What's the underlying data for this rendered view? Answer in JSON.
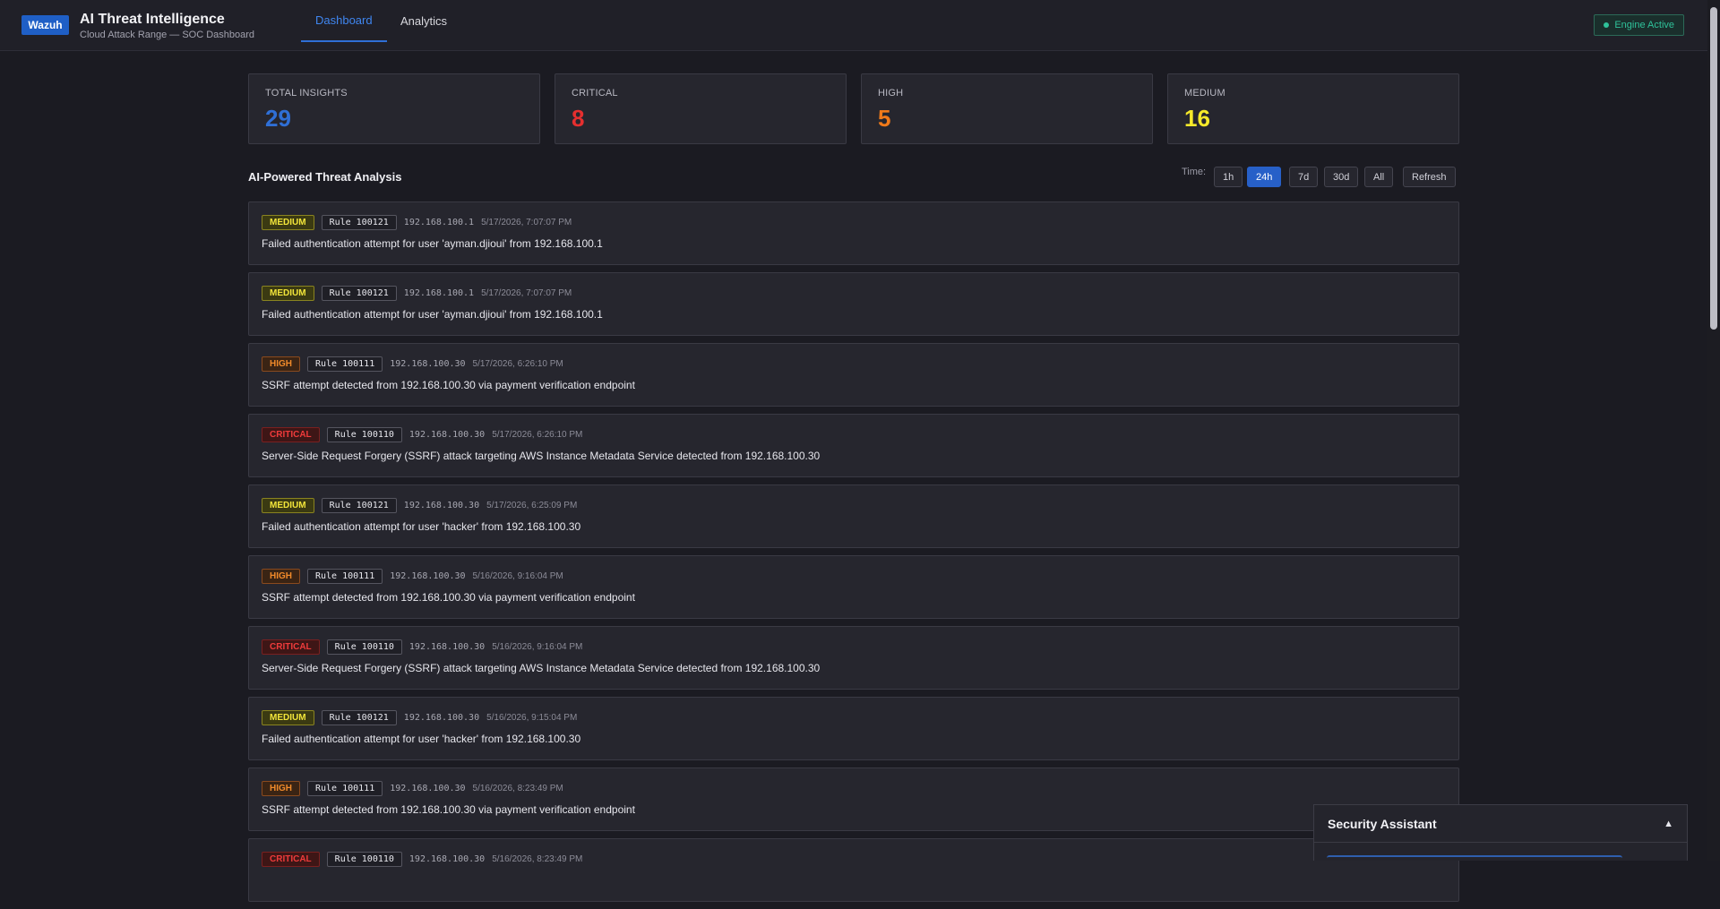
{
  "header": {
    "logo": "Wazuh",
    "title": "AI Threat Intelligence",
    "subtitle": "Cloud Attack Range — SOC Dashboard",
    "tabs": [
      {
        "label": "Dashboard",
        "active": true
      },
      {
        "label": "Analytics",
        "active": false
      }
    ],
    "engine_status": "Engine Active"
  },
  "stats": [
    {
      "label": "TOTAL INSIGHTS",
      "value": "29",
      "color": "#2f6fd6"
    },
    {
      "label": "CRITICAL",
      "value": "8",
      "color": "#e52f2f"
    },
    {
      "label": "HIGH",
      "value": "5",
      "color": "#f07a1a"
    },
    {
      "label": "MEDIUM",
      "value": "16",
      "color": "#f5e92a"
    }
  ],
  "section": {
    "title": "AI-Powered Threat Analysis",
    "time_label": "Time:",
    "time_options": [
      "1h",
      "24h",
      "7d",
      "30d",
      "All"
    ],
    "time_selected": "24h",
    "refresh_label": "Refresh"
  },
  "insights": [
    {
      "severity": "MEDIUM",
      "rule": "Rule 100121",
      "ip": "192.168.100.1",
      "time": "5/17/2026, 7:07:07 PM",
      "description": "Failed authentication attempt for user 'ayman.djioui' from 192.168.100.1"
    },
    {
      "severity": "MEDIUM",
      "rule": "Rule 100121",
      "ip": "192.168.100.1",
      "time": "5/17/2026, 7:07:07 PM",
      "description": "Failed authentication attempt for user 'ayman.djioui' from 192.168.100.1"
    },
    {
      "severity": "HIGH",
      "rule": "Rule 100111",
      "ip": "192.168.100.30",
      "time": "5/17/2026, 6:26:10 PM",
      "description": "SSRF attempt detected from 192.168.100.30 via payment verification endpoint"
    },
    {
      "severity": "CRITICAL",
      "rule": "Rule 100110",
      "ip": "192.168.100.30",
      "time": "5/17/2026, 6:26:10 PM",
      "description": "Server-Side Request Forgery (SSRF) attack targeting AWS Instance Metadata Service detected from 192.168.100.30"
    },
    {
      "severity": "MEDIUM",
      "rule": "Rule 100121",
      "ip": "192.168.100.30",
      "time": "5/17/2026, 6:25:09 PM",
      "description": "Failed authentication attempt for user 'hacker' from 192.168.100.30"
    },
    {
      "severity": "HIGH",
      "rule": "Rule 100111",
      "ip": "192.168.100.30",
      "time": "5/16/2026, 9:16:04 PM",
      "description": "SSRF attempt detected from 192.168.100.30 via payment verification endpoint"
    },
    {
      "severity": "CRITICAL",
      "rule": "Rule 100110",
      "ip": "192.168.100.30",
      "time": "5/16/2026, 9:16:04 PM",
      "description": "Server-Side Request Forgery (SSRF) attack targeting AWS Instance Metadata Service detected from 192.168.100.30"
    },
    {
      "severity": "MEDIUM",
      "rule": "Rule 100121",
      "ip": "192.168.100.30",
      "time": "5/16/2026, 9:15:04 PM",
      "description": "Failed authentication attempt for user 'hacker' from 192.168.100.30"
    },
    {
      "severity": "HIGH",
      "rule": "Rule 100111",
      "ip": "192.168.100.30",
      "time": "5/16/2026, 8:23:49 PM",
      "description": "SSRF attempt detected from 192.168.100.30 via payment verification endpoint"
    },
    {
      "severity": "CRITICAL",
      "rule": "Rule 100110",
      "ip": "192.168.100.30",
      "time": "5/16/2026, 8:23:49 PM",
      "description": ""
    }
  ],
  "assistant": {
    "title": "Security Assistant",
    "toggle_icon": "chevron-up-icon",
    "toggle_glyph": "▲"
  }
}
